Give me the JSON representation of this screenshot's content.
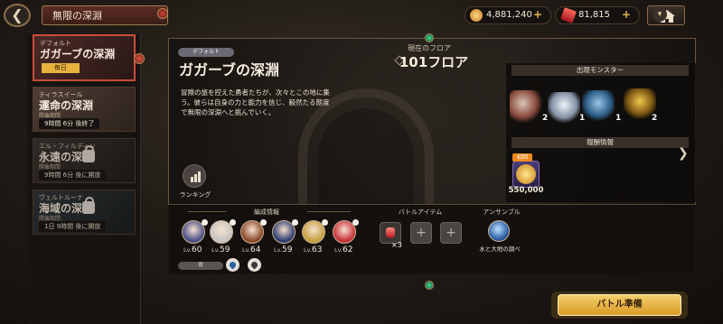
{
  "header": {
    "title": "無限の深淵",
    "back_icon": "arrow-left-icon",
    "resources": {
      "gold": {
        "value": "4,881,240",
        "plus": "+"
      },
      "gems": {
        "value": "81,815",
        "plus": "+"
      }
    }
  },
  "sidebar": {
    "dungeons": [
      {
        "subtitle": "デフォルト",
        "name": "ガガーブの深淵",
        "badge": "毎日",
        "period_label": "",
        "time": "",
        "locked": false,
        "selected": true
      },
      {
        "subtitle": "ティラスイール",
        "name": "運命の深淵",
        "badge": "",
        "period_label": "開催期間",
        "time": "9時間 6分 後終了",
        "locked": false,
        "selected": false
      },
      {
        "subtitle": "エル・フィルディン",
        "name": "永遠の深淵",
        "badge": "",
        "period_label": "開催期間",
        "time": "9時間 6分 後に開放",
        "locked": true,
        "selected": false
      },
      {
        "subtitle": "ヴェルトルーナ",
        "name": "海域の深淵",
        "badge": "",
        "period_label": "開催期間",
        "time": "1日 9時間 後に開放",
        "locked": true,
        "selected": false
      }
    ]
  },
  "main": {
    "tag": "デフォルト",
    "title": "ガガーブの深淵",
    "description": "冒険の旅を控えた勇者たちが、次々とこの地に集う。彼らは自身の力と能力を信じ、毅然たる態度で無限の深淵へと挑んでいく。",
    "floor_label": "現在のフロア",
    "floor_value": "101フロア",
    "ranking_label": "ランキング",
    "monsters_header": "出現モンスター",
    "monster_counts": [
      "2",
      "1",
      "1",
      "2"
    ],
    "rewards_header": "報酬情報",
    "reward_tag": "初回",
    "reward_amount": "550,000"
  },
  "bottom": {
    "formation_header": "編成情報",
    "items_header": "バトルアイテム",
    "ensemble_header": "アンサンブル",
    "lv_prefix": "Lv.",
    "units": [
      "60",
      "59",
      "64",
      "59",
      "63",
      "62"
    ],
    "potion_count": "×3",
    "empty_slot_symbol": "+",
    "ensemble_name": "水と大地の調べ",
    "attribute_label": "弱"
  },
  "battle_button_label": "バトル準備",
  "colors": {
    "accent_gold": "#e7b23e",
    "selected_border": "#c94b3b",
    "panel_border": "#6b5540"
  }
}
